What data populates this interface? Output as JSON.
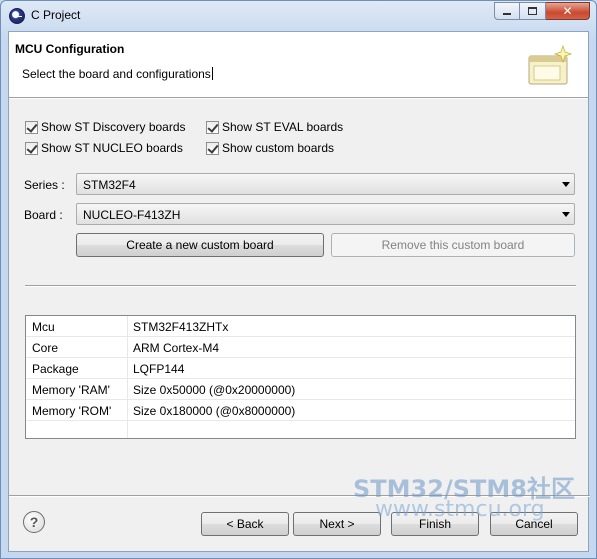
{
  "window": {
    "title": "C Project"
  },
  "window_controls": {
    "minimize": "minimize",
    "maximize": "maximize",
    "close": "✕"
  },
  "banner": {
    "title": "MCU Configuration",
    "message": "Select the board and configurations"
  },
  "checkboxes": [
    {
      "label": "Show ST Discovery boards",
      "checked": true
    },
    {
      "label": "Show ST EVAL boards",
      "checked": true
    },
    {
      "label": "Show ST NUCLEO boards",
      "checked": true
    },
    {
      "label": "Show custom boards",
      "checked": true
    }
  ],
  "series": {
    "label": "Series :",
    "value": "STM32F4"
  },
  "board": {
    "label": "Board :",
    "value": "NUCLEO-F413ZH"
  },
  "buttons": {
    "create_custom": "Create a new custom board",
    "remove_custom": "Remove this custom board"
  },
  "properties": [
    {
      "key": "Mcu",
      "value": "STM32F413ZHTx"
    },
    {
      "key": "Core",
      "value": "ARM Cortex-M4"
    },
    {
      "key": "Package",
      "value": "LQFP144"
    },
    {
      "key": "Memory 'RAM'",
      "value": "Size 0x50000 (@0x20000000)"
    },
    {
      "key": "Memory 'ROM'",
      "value": "Size 0x180000 (@0x8000000)"
    }
  ],
  "footer": {
    "help": "?",
    "back": "< Back",
    "next": "Next >",
    "finish": "Finish",
    "cancel": "Cancel"
  },
  "watermark": {
    "line1": "STM32/STM8社区",
    "line2": "www.stmcu.org"
  }
}
